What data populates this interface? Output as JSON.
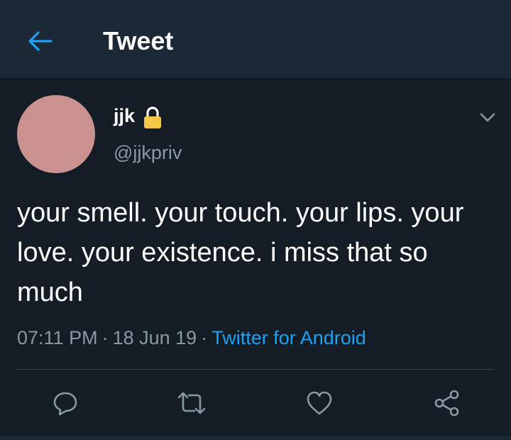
{
  "header": {
    "title": "Tweet",
    "back_icon": "arrow-left-icon",
    "accent_color": "#1da1f2"
  },
  "tweet": {
    "author": {
      "display_name": "jjk",
      "handle": "@jjkpriv",
      "avatar_color": "#c9928f",
      "protected_icon": "lock-icon"
    },
    "text": "your smell. your touch. your lips. your love. your existence. i miss that so much",
    "meta": {
      "time": "07:11 PM",
      "separator": "·",
      "date": "18 Jun 19",
      "source": "Twitter for Android"
    },
    "actions": [
      {
        "icon": "reply-icon"
      },
      {
        "icon": "retweet-icon"
      },
      {
        "icon": "like-icon"
      },
      {
        "icon": "share-icon"
      }
    ]
  }
}
